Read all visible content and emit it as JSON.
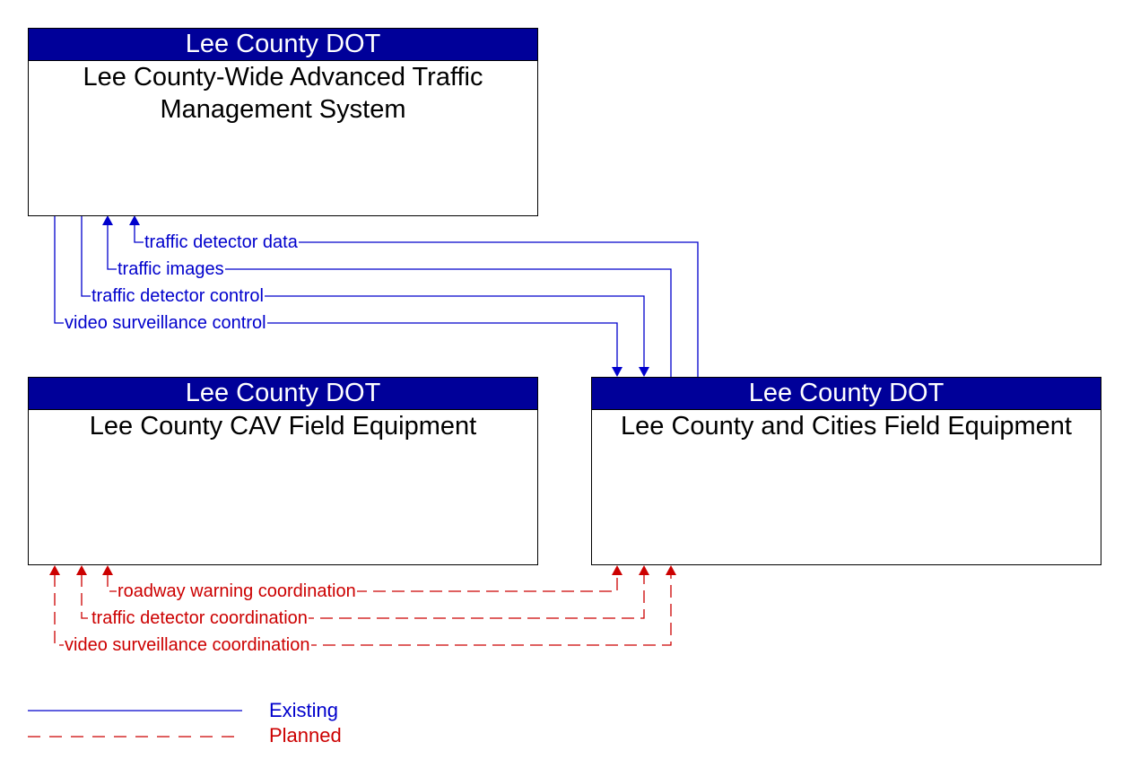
{
  "colors": {
    "header_bg": "#000099",
    "existing": "#0000cc",
    "planned": "#cc0000"
  },
  "boxes": {
    "atms": {
      "owner": "Lee County DOT",
      "name": "Lee County-Wide Advanced Traffic Management System"
    },
    "cav": {
      "owner": "Lee County DOT",
      "name": "Lee County CAV Field Equipment"
    },
    "field": {
      "owner": "Lee County DOT",
      "name": "Lee County and Cities Field Equipment"
    }
  },
  "flows": {
    "existing": [
      {
        "label": "traffic detector data",
        "from": "Lee County and Cities Field Equipment",
        "to": "Lee County-Wide Advanced Traffic Management System"
      },
      {
        "label": "traffic images",
        "from": "Lee County and Cities Field Equipment",
        "to": "Lee County-Wide Advanced Traffic Management System"
      },
      {
        "label": "traffic detector control",
        "from": "Lee County-Wide Advanced Traffic Management System",
        "to": "Lee County and Cities Field Equipment"
      },
      {
        "label": "video surveillance control",
        "from": "Lee County-Wide Advanced Traffic Management System",
        "to": "Lee County and Cities Field Equipment"
      }
    ],
    "planned": [
      {
        "label": "roadway warning coordination",
        "direction": "bidirectional"
      },
      {
        "label": "traffic detector coordination",
        "direction": "bidirectional"
      },
      {
        "label": "video surveillance coordination",
        "direction": "bidirectional"
      }
    ]
  },
  "legend": {
    "existing": "Existing",
    "planned": "Planned"
  }
}
